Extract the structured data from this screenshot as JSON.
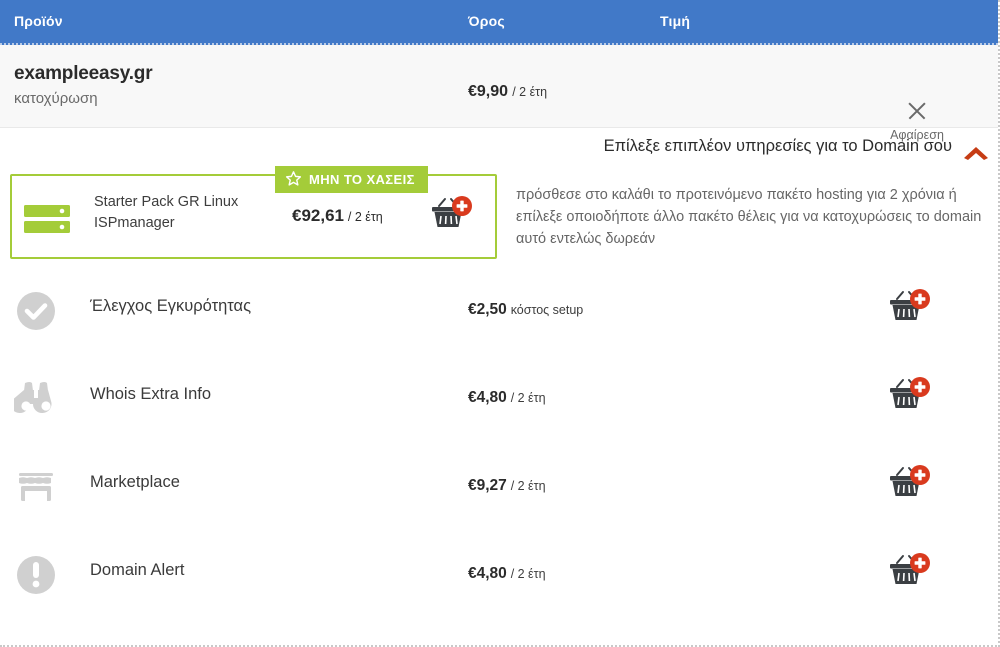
{
  "table_header": {
    "product": "Προϊόν",
    "term": "Όρος",
    "price": "Τιμή"
  },
  "colors": {
    "header_blue": "#4179c8",
    "promo_green": "#a4cc39",
    "chevron_orange": "#c63c14",
    "cart_plus_red": "#d93a1e",
    "icon_gray": "#d0d0d0",
    "basket_dark": "#3b3f43"
  },
  "domain_row": {
    "name": "exampleeasy.gr",
    "subtitle": "κατοχύρωση",
    "price_amount": "€9,90",
    "price_period": "/ 2 έτη",
    "remove_label": "Αφαίρεση",
    "remove_icon": "close-x-icon"
  },
  "addons_section": {
    "title": "Επίλεξε επιπλέον υπηρεσίες για το Domain σου",
    "toggle_icon": "chevron-up-icon"
  },
  "promo": {
    "badge_label": "ΜΗΝ ΤΟ ΧΑΣΕΙΣ",
    "badge_icon": "star-icon",
    "icon": "server-icon",
    "name": "Starter Pack GR Linux ISPmanager",
    "price_amount": "€92,61",
    "price_period": "/ 2 έτη",
    "cart_icon": "add-to-cart-basket-icon",
    "description": "πρόσθεσε στο καλάθι το προτεινόμενο πακέτο hosting για 2 χρόνια ή επίλεξε οποιοδήποτε άλλο πακέτο θέλεις για να κατοχυρώσεις το domain αυτό εντελώς δωρεάν"
  },
  "addons": [
    {
      "icon": "check-circle-icon",
      "name": "Έλεγχος Εγκυρότητας",
      "price_amount": "€2,50",
      "price_period": "κόστος setup",
      "cart_icon": "add-to-cart-basket-icon"
    },
    {
      "icon": "binoculars-icon",
      "name": "Whois Extra Info",
      "price_amount": "€4,80",
      "price_period": "/ 2 έτη",
      "cart_icon": "add-to-cart-basket-icon"
    },
    {
      "icon": "storefront-icon",
      "name": "Marketplace",
      "price_amount": "€9,27",
      "price_period": "/ 2 έτη",
      "cart_icon": "add-to-cart-basket-icon"
    },
    {
      "icon": "alert-exclamation-icon",
      "name": "Domain Alert",
      "price_amount": "€4,80",
      "price_period": "/ 2 έτη",
      "cart_icon": "add-to-cart-basket-icon"
    }
  ]
}
